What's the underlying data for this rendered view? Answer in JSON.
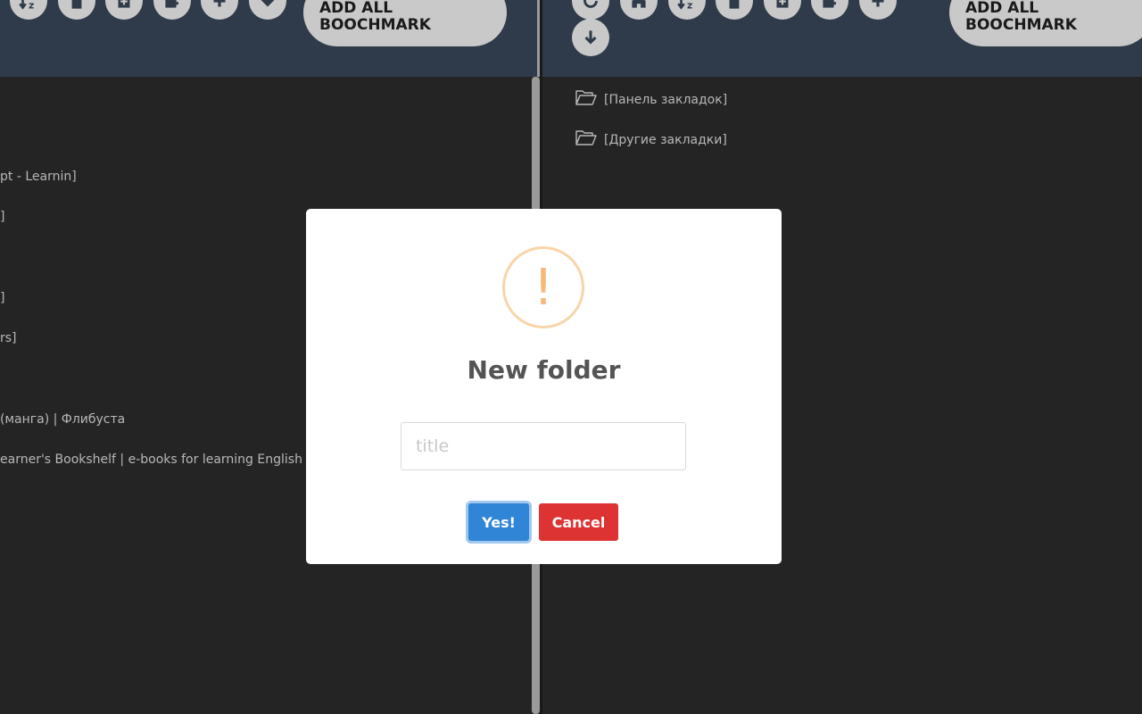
{
  "left_pane": {
    "add_all_label": "ADD ALL\nBOOCHMARK",
    "items": [
      "pt - Learnin]",
      "]",
      "]",
      "rs]",
      "(манга) | Флибуста",
      "earner's Bookshelf | e-books for learning English"
    ]
  },
  "right_pane": {
    "add_all_label": "ADD ALL\nBOOCHMARK",
    "folders": [
      "[Панель закладок]",
      "[Другие закладки]"
    ]
  },
  "dialog": {
    "icon": "warning-icon",
    "icon_char": "!",
    "title": "New folder",
    "input_value": "",
    "input_placeholder": "title",
    "confirm_label": "Yes!",
    "cancel_label": "Cancel"
  },
  "colors": {
    "toolbar": "#2f3b4b",
    "background": "#242424",
    "confirm": "#3085d6",
    "cancel": "#dd3333",
    "warning": "#f6b97a"
  }
}
